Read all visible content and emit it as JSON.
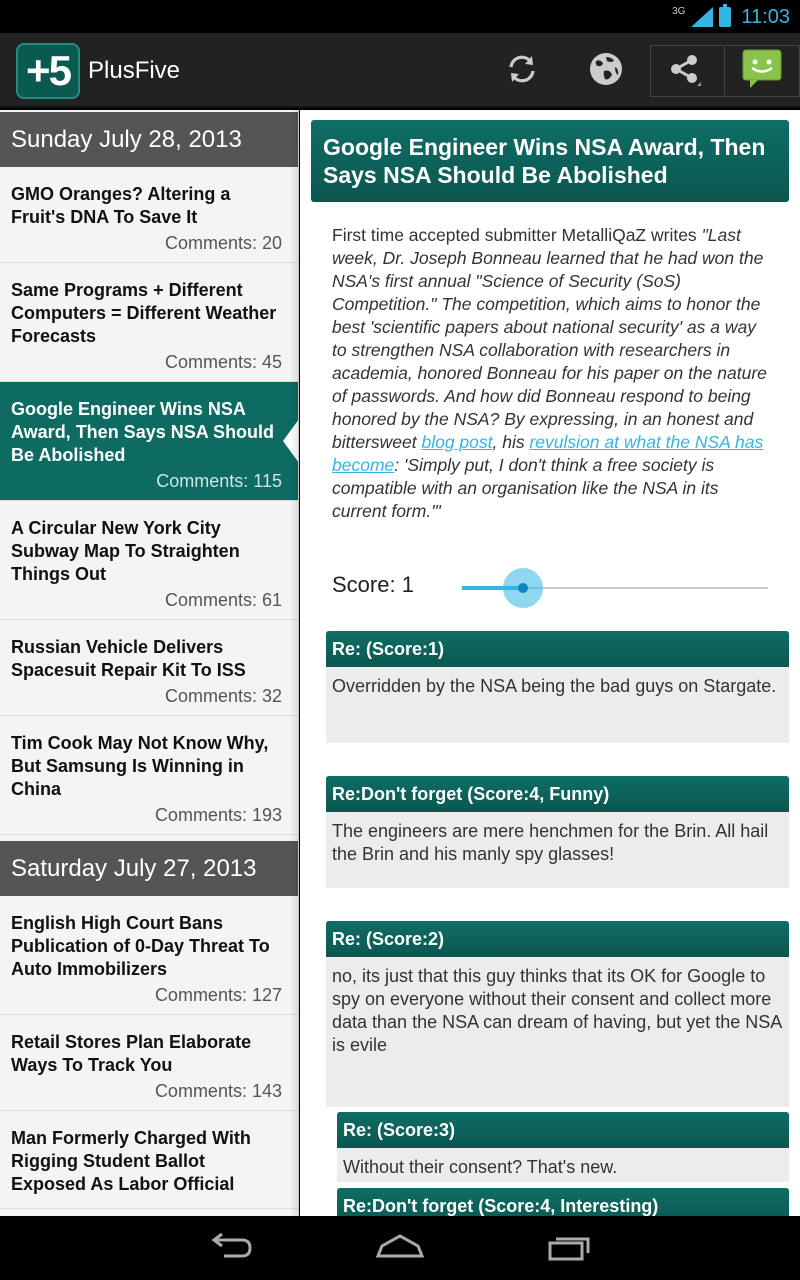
{
  "status_bar": {
    "network": "3G",
    "time": "11:03"
  },
  "action_bar": {
    "logo_text": "+5",
    "app_title": "PlusFive",
    "icons": [
      "refresh-icon",
      "globe-icon",
      "share-icon",
      "overflow-android-icon"
    ]
  },
  "stories": {
    "day1": "Sunday July 28, 2013",
    "items_day1": [
      {
        "title": "GMO Oranges? Altering a Fruit's DNA To Save It",
        "comments": "Comments: 20"
      },
      {
        "title": "Same Programs + Different Computers = Different Weather Forecasts",
        "comments": "Comments: 45"
      },
      {
        "title": "Google Engineer Wins NSA Award, Then Says NSA Should Be Abolished",
        "comments": "Comments: 115"
      },
      {
        "title": "A Circular New York City Subway Map To Straighten Things Out",
        "comments": "Comments: 61"
      },
      {
        "title": "Russian Vehicle Delivers Spacesuit Repair Kit To ISS",
        "comments": "Comments: 32"
      },
      {
        "title": "Tim Cook May Not Know Why, But Samsung Is Winning in China",
        "comments": "Comments: 193"
      }
    ],
    "day2": "Saturday July 27, 2013",
    "items_day2": [
      {
        "title": "English High Court Bans Publication of 0-Day Threat To Auto Immobilizers",
        "comments": "Comments: 127"
      },
      {
        "title": "Retail Stores Plan Elaborate Ways To Track You",
        "comments": "Comments: 143"
      },
      {
        "title": "Man Formerly Charged With Rigging Student Ballot Exposed As Labor Official",
        "comments": ""
      }
    ]
  },
  "article": {
    "title": "Google Engineer Wins NSA Award, Then Says NSA Should Be Abolished",
    "intro": "First time accepted submitter MetalliQaZ writes",
    "quote_part1": "\"Last week, Dr. Joseph Bonneau learned that he had won the NSA's first annual \"Science of Security (SoS) Competition.\" The competition, which aims to honor the best 'scientific papers about national security' as a way to strengthen NSA collaboration with researchers in academia, honored Bonneau for his paper on the nature of passwords. And how did Bonneau respond to being honored by the NSA? By expressing, in an honest and bittersweet ",
    "link1": "blog post",
    "quote_part2": ", his ",
    "link2": "revulsion at what the NSA has become",
    "quote_part3": ": 'Simply put, I don't think a free society is compatible with an organisation like the NSA in its current form.'\""
  },
  "score": {
    "label": "Score: 1",
    "value": 1,
    "min": 0,
    "max": 5
  },
  "comments": [
    {
      "head": "Re: (Score:1)",
      "text": "Overridden by the NSA being the bad guys on Stargate."
    },
    {
      "head": "Re:Don't forget (Score:4, Funny)",
      "text": "The engineers are mere henchmen for the Brin. All hail the Brin and his manly spy glasses!"
    },
    {
      "head": "Re: (Score:2)",
      "text": "no, its just that this guy thinks that its OK for Google to spy on everyone without their consent and collect more data than the NSA can dream of having, but yet the NSA is evile"
    },
    {
      "head": "Re: (Score:3)",
      "text": "Without their consent? That's new."
    },
    {
      "head": "Re:Don't forget (Score:4, Interesting)",
      "text": ""
    }
  ],
  "colors": {
    "accent_teal": "#0d6b62",
    "holo_blue": "#33b5e5"
  }
}
